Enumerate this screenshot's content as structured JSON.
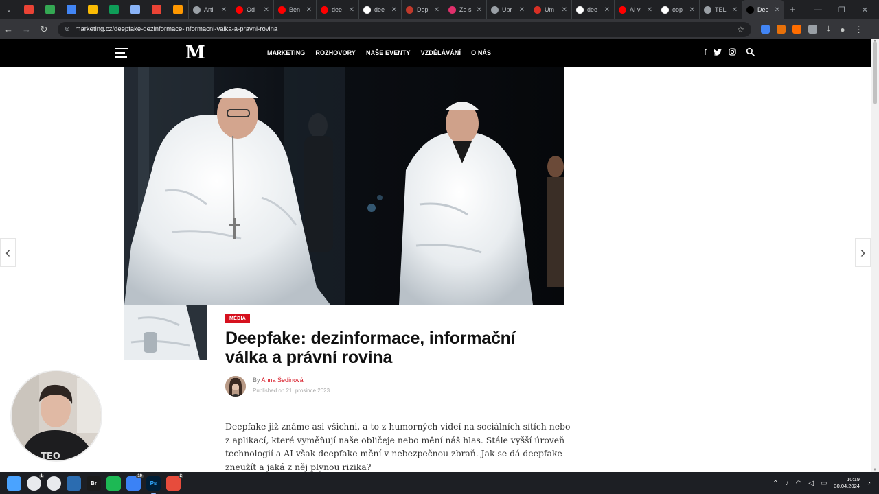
{
  "browser": {
    "tabs": [
      {
        "title": "Arti",
        "favicon_color": "#9aa0a6",
        "icon": "globe-icon"
      },
      {
        "title": "Od",
        "favicon_color": "#ff0000",
        "icon": "youtube-icon"
      },
      {
        "title": "Ben",
        "favicon_color": "#ff0000",
        "icon": "youtube-icon"
      },
      {
        "title": "dee",
        "favicon_color": "#ff0000",
        "icon": "youtube-icon"
      },
      {
        "title": "dee",
        "favicon_color": "#ffffff",
        "icon": "google-icon"
      },
      {
        "title": "Dop",
        "favicon_color": "#c0392b",
        "icon": "flag-icon"
      },
      {
        "title": "Ze s",
        "favicon_color": "#e1306c",
        "icon": "instagram-icon"
      },
      {
        "title": "Upr",
        "favicon_color": "#9aa0a6",
        "icon": "globe-icon"
      },
      {
        "title": "Um",
        "favicon_color": "#d93025",
        "icon": "globe-icon"
      },
      {
        "title": "dee",
        "favicon_color": "#ffffff",
        "icon": "google-icon"
      },
      {
        "title": "AI v",
        "favicon_color": "#ff0000",
        "icon": "youtube-icon"
      },
      {
        "title": "oop",
        "favicon_color": "#ffffff",
        "icon": "google-icon"
      },
      {
        "title": "TEL",
        "favicon_color": "#9aa0a6",
        "icon": "globe-icon"
      },
      {
        "title": "Dee",
        "favicon_color": "#000000",
        "icon": "marketing-icon",
        "active": true
      }
    ],
    "pinned_favicons": [
      "#ea4335",
      "#34a853",
      "#4285f4",
      "#fbbc04",
      "#0f9d58",
      "#8ab4f8",
      "#ea4335",
      "#ff9800"
    ],
    "url": "marketing.cz/deepfake-dezinformace-informacni-valka-a-pravni-rovina",
    "extension_colors": [
      "#4285f4",
      "#e8710a",
      "#ff6d00",
      "#9aa0a6"
    ]
  },
  "site": {
    "logo": "M",
    "nav": [
      "MARKETING",
      "ROZHOVORY",
      "NAŠE EVENTY",
      "VZDĚLÁVÁNÍ",
      "O NÁS"
    ],
    "social": {
      "facebook": "f",
      "twitter": "t",
      "instagram": "◎",
      "search": "⌕"
    }
  },
  "article": {
    "category": "MÉDIA",
    "title": "Deepfake: dezinformace, informační válka a právní rovina",
    "byline_prefix": "By",
    "author": "Anna Šedinová",
    "published": "Published on 21. prosince 2023",
    "lead": "Deepfake již známe asi všichni, a to z humorných videí na sociálních sítích nebo z aplikací, které vyměňují naše obličeje nebo mění náš hlas. Stále vyšší úroveň technologií a AI však deepfake mění v nebezpečnou zbraň. Jak se dá deepfake zneužít a jaká z něj plynou rizika?"
  },
  "taskbar": {
    "apps": [
      {
        "name": "windows-start",
        "color": "#4aa3ff",
        "label": ""
      },
      {
        "name": "chrome",
        "color": "#e8eaed",
        "label": "",
        "badge": "1"
      },
      {
        "name": "chrome-2",
        "color": "#e8eaed",
        "label": ""
      },
      {
        "name": "save",
        "color": "#2b6cb0",
        "label": ""
      },
      {
        "name": "bridge",
        "color": "#1b1b1b",
        "label": "Br"
      },
      {
        "name": "spotify",
        "color": "#1db954",
        "label": ""
      },
      {
        "name": "app-c",
        "color": "#3b82f6",
        "label": "",
        "badge": "10"
      },
      {
        "name": "photoshop",
        "color": "#001e36",
        "label": "Ps",
        "active": true
      },
      {
        "name": "app-red",
        "color": "#e74c3c",
        "label": "",
        "badge": "2"
      }
    ],
    "time": "10:19",
    "date": "30.04.2024"
  }
}
